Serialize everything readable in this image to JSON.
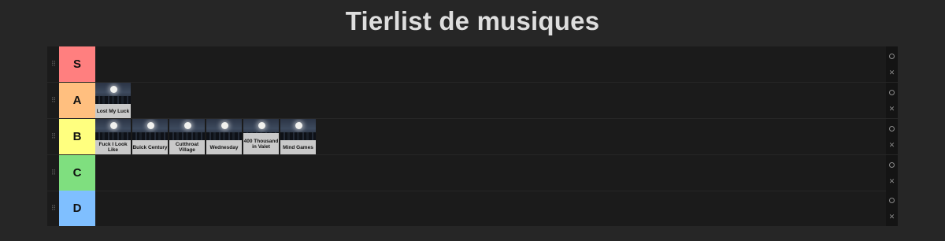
{
  "header": {
    "title": "Tierlist de musiques"
  },
  "icons": {
    "handle": "drag-handle-icon",
    "settings": "settings-icon",
    "delete": "close-icon"
  },
  "glyphs": {
    "handle": "⠿",
    "delete": "✕"
  },
  "tiers": [
    {
      "label": "S",
      "color": "#ff7f7f",
      "items": []
    },
    {
      "label": "A",
      "color": "#ffbf7f",
      "items": [
        {
          "title": "Lost My Luck"
        }
      ]
    },
    {
      "label": "B",
      "color": "#ffff7f",
      "items": [
        {
          "title": "Fuck I Look Like"
        },
        {
          "title": "Buick Century"
        },
        {
          "title": "Cutthroat Village"
        },
        {
          "title": "Wednesday"
        },
        {
          "title": "400 Thousand in Valet"
        },
        {
          "title": "Mind Games"
        }
      ]
    },
    {
      "label": "C",
      "color": "#7fdf7f",
      "items": []
    },
    {
      "label": "D",
      "color": "#7fbfff",
      "items": []
    }
  ]
}
